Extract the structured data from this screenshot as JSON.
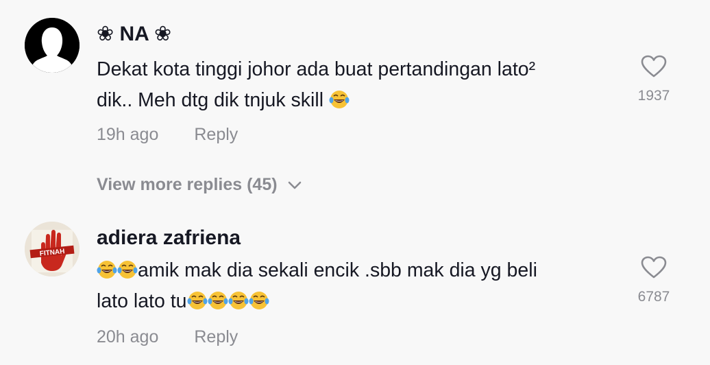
{
  "comments": [
    {
      "username": "❀ NA ❀",
      "text_line1": "Dekat kota tinggi johor ada buat pertandingan lato²",
      "text_line2_prefix": "dik.. Meh dtg dik tnjuk skill ",
      "time": "19h ago",
      "reply_label": "Reply",
      "likes": "1937",
      "view_more": "View more replies (45)"
    },
    {
      "username": "adiera zafriena",
      "text_line1_suffix": "amik mak dia sekali encik .sbb mak dia yg beli",
      "text_line2_prefix": "lato lato tu",
      "time": "20h ago",
      "reply_label": "Reply",
      "likes": "6787",
      "avatar_text": "FITNAH"
    }
  ],
  "icons": {
    "like": "heart-outline-icon",
    "emoji": "face-with-tears-of-joy-emoji",
    "expand": "chevron-down-icon"
  },
  "colors": {
    "background": "#f8f8f8",
    "primary_text": "#161823",
    "secondary_text": "#8a8b91",
    "emoji_yellow": "#f7c236"
  }
}
